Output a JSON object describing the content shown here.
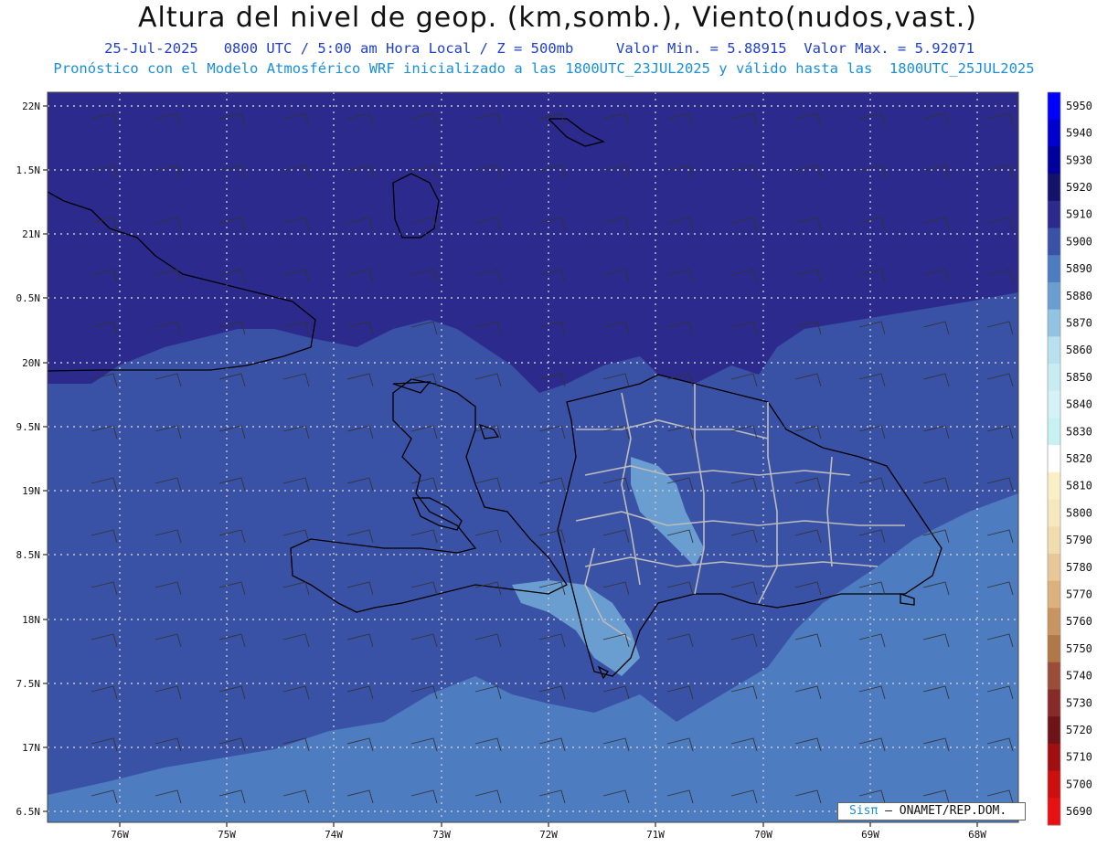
{
  "header": {
    "title": "Altura del nivel de geop. (km,somb.), Viento(nudos,vast.)",
    "line1": "25-Jul-2025   0800 UTC / 5:00 am Hora Local / Z = 500mb     Valor Min. = 5.88915  Valor Max. = 5.92071",
    "line2": "Pronóstico con el Modelo Atmosférico WRF inicializado a las 1800UTC_23JUL2025 y válido hasta las  1800UTC_25JUL2025"
  },
  "axes": {
    "lat_labels": [
      "22N",
      "1.5N",
      "21N",
      "0.5N",
      "20N",
      "9.5N",
      "19N",
      "8.5N",
      "18N",
      "7.5N",
      "17N",
      "6.5N"
    ],
    "lon_labels": [
      "76W",
      "75W",
      "74W",
      "73W",
      "72W",
      "71W",
      "70W",
      "69W",
      "68W"
    ]
  },
  "colorbar": {
    "levels": [
      "5950",
      "5940",
      "5930",
      "5920",
      "5910",
      "5900",
      "5890",
      "5880",
      "5870",
      "5860",
      "5850",
      "5840",
      "5830",
      "5820",
      "5810",
      "5800",
      "5790",
      "5780",
      "5770",
      "5760",
      "5750",
      "5740",
      "5730",
      "5720",
      "5710",
      "5700",
      "5690"
    ],
    "colors": [
      "#0000ff",
      "#0000cd",
      "#00009a",
      "#14126a",
      "#2c2a8c",
      "#3a52a6",
      "#4e7cc0",
      "#6a9ed0",
      "#93c3e2",
      "#b8e0ee",
      "#c8ecf2",
      "#d6f2f6",
      "#c7f1f3",
      "#ffffff",
      "#f9f0c8",
      "#f6e8be",
      "#f0dcae",
      "#e8c898",
      "#dcb27c",
      "#c89460",
      "#b07848",
      "#9a4e3a",
      "#882a2a",
      "#6e1418",
      "#a01010",
      "#cc1010",
      "#e81010"
    ]
  },
  "fill_colors": {
    "z5910": "#2c2a8c",
    "z5900": "#3a52a6",
    "z5890": "#4e7cc0",
    "z5880": "#6a9ed0"
  },
  "credit": {
    "logo": "Sisπ",
    "text": "– ONAMET/REP.DOM."
  }
}
